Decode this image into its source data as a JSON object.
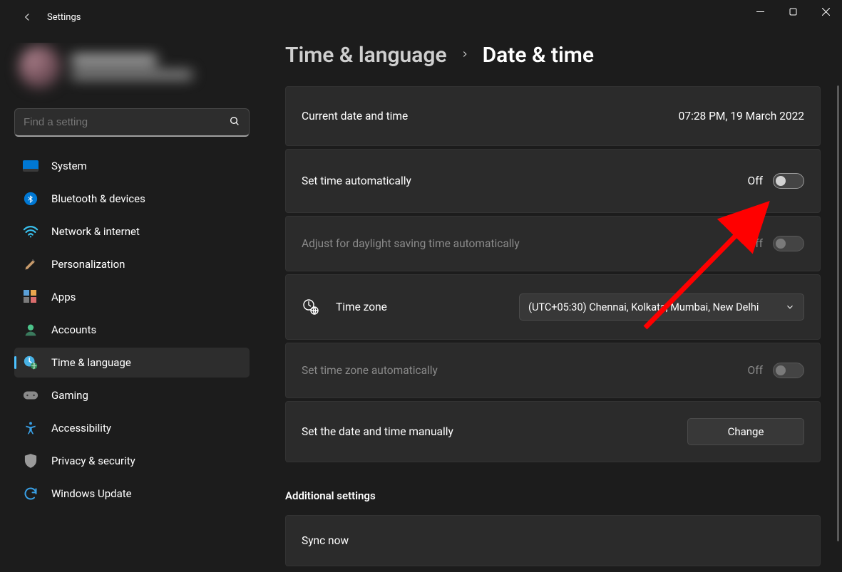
{
  "titlebar": {
    "app_title": "Settings"
  },
  "search": {
    "placeholder": "Find a setting"
  },
  "sidebar": {
    "items": [
      {
        "label": "System"
      },
      {
        "label": "Bluetooth & devices"
      },
      {
        "label": "Network & internet"
      },
      {
        "label": "Personalization"
      },
      {
        "label": "Apps"
      },
      {
        "label": "Accounts"
      },
      {
        "label": "Time & language"
      },
      {
        "label": "Gaming"
      },
      {
        "label": "Accessibility"
      },
      {
        "label": "Privacy & security"
      },
      {
        "label": "Windows Update"
      }
    ]
  },
  "breadcrumb": {
    "parent": "Time & language",
    "current": "Date & time"
  },
  "cards": {
    "current_dt_label": "Current date and time",
    "current_dt_value": "07:28 PM, 19 March 2022",
    "set_time_auto_label": "Set time automatically",
    "set_time_auto_state": "Off",
    "dst_auto_label": "Adjust for daylight saving time automatically",
    "dst_auto_state": "Off",
    "tz_label": "Time zone",
    "tz_value": "(UTC+05:30) Chennai, Kolkata, Mumbai, New Delhi",
    "set_tz_auto_label": "Set time zone automatically",
    "set_tz_auto_state": "Off",
    "manual_label": "Set the date and time manually",
    "change_button": "Change",
    "additional_heading": "Additional settings",
    "sync_label": "Sync now"
  }
}
